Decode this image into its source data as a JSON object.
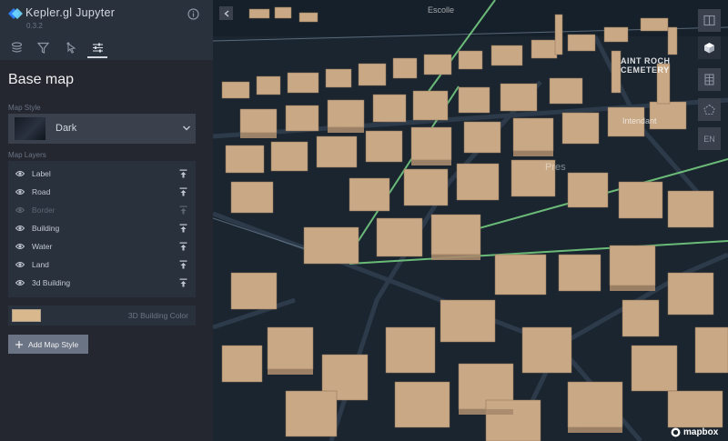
{
  "app": {
    "title": "Kepler.gl Jupyter",
    "version": "0.3.2"
  },
  "tabs": [
    {
      "id": "layers",
      "icon": "layers-icon"
    },
    {
      "id": "filters",
      "icon": "filter-icon"
    },
    {
      "id": "interactions",
      "icon": "cursor-icon"
    },
    {
      "id": "basemap",
      "icon": "sliders-icon",
      "active": true
    }
  ],
  "panel": {
    "section_title": "Base map",
    "map_style_label": "Map Style",
    "map_style_value": "Dark",
    "map_layers_label": "Map Layers",
    "layers": [
      {
        "label": "Label",
        "visible": true
      },
      {
        "label": "Road",
        "visible": true
      },
      {
        "label": "Border",
        "visible": false
      },
      {
        "label": "Building",
        "visible": true
      },
      {
        "label": "Water",
        "visible": true
      },
      {
        "label": "Land",
        "visible": true
      },
      {
        "label": "3d Building",
        "visible": true
      }
    ],
    "building_color_label": "3D Building Color",
    "add_map_style_label": "Add Map Style"
  },
  "map": {
    "labels": {
      "rochet": "AINT ROCH\nCEMETERY",
      "intendant": "Intendant",
      "street": "Pres",
      "top": "Escolle"
    },
    "locale": "EN",
    "attribution": "mapbox"
  },
  "colors": {
    "panel_bg": "#242730",
    "header_bg": "#29323c",
    "accent": "#4cc9ff",
    "building": "#d0b08f",
    "building_color_swatch": "#d8b88c",
    "map_bg": "#1a2530",
    "green_route": "#7fe08a"
  }
}
